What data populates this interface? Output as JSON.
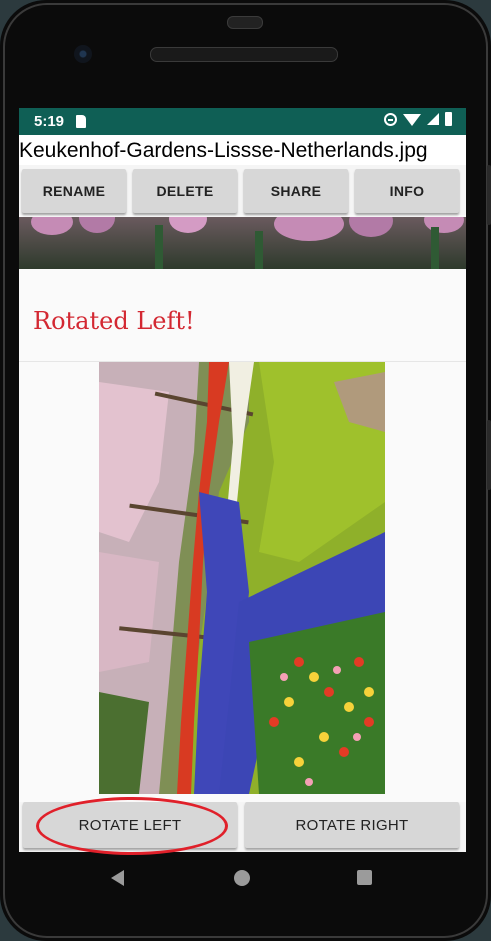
{
  "status_bar": {
    "time": "5:19",
    "icons": [
      "sd-card-icon",
      "do-not-disturb-icon",
      "wifi-icon",
      "signal-icon",
      "battery-icon"
    ],
    "color": "#0f5f55"
  },
  "title": "Keukenhof-Gardens-Lissse-Netherlands.jpg",
  "toolbar": {
    "rename": "RENAME",
    "delete": "DELETE",
    "share": "SHARE",
    "info": "INFO"
  },
  "message": {
    "text": "Rotated Left!",
    "color": "#d32832"
  },
  "rotate": {
    "left": "ROTATE LEFT",
    "right": "ROTATE RIGHT"
  },
  "annotation_color": "#e0202a",
  "nav_bar": {
    "icons": [
      "back-icon",
      "home-icon",
      "recents-icon"
    ]
  }
}
